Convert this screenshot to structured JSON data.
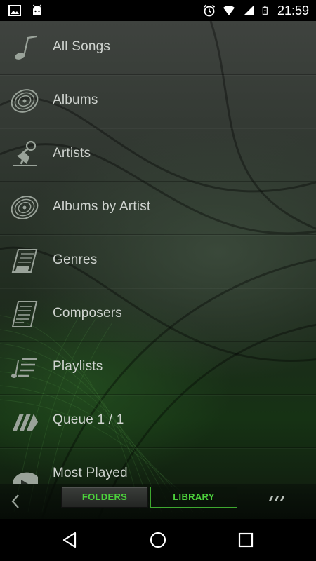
{
  "status_bar": {
    "time": "21:59",
    "left_icons": [
      "image-icon",
      "android-icon"
    ],
    "right_icons": [
      "alarm-icon",
      "wifi-icon",
      "signal-icon",
      "battery-charging-icon"
    ]
  },
  "menu": {
    "items": [
      {
        "label": "All Songs",
        "icon": "music-note-icon"
      },
      {
        "label": "Albums",
        "icon": "vinyl-record-icon"
      },
      {
        "label": "Artists",
        "icon": "singer-microphone-icon"
      },
      {
        "label": "Albums by Artist",
        "icon": "vinyl-record-icon"
      },
      {
        "label": "Genres",
        "icon": "keyboard-icon"
      },
      {
        "label": "Composers",
        "icon": "sheet-music-icon"
      },
      {
        "label": "Playlists",
        "icon": "playlist-icon"
      },
      {
        "label": "Queue  1 / 1",
        "icon": "queue-icon"
      },
      {
        "label": "Most Played",
        "icon": "most-played-icon"
      }
    ]
  },
  "toolbar": {
    "folders_label": "FOLDERS",
    "library_label": "LIBRARY"
  },
  "colors": {
    "accent": "#4cd13c",
    "label_text": "#cfd3cf"
  }
}
